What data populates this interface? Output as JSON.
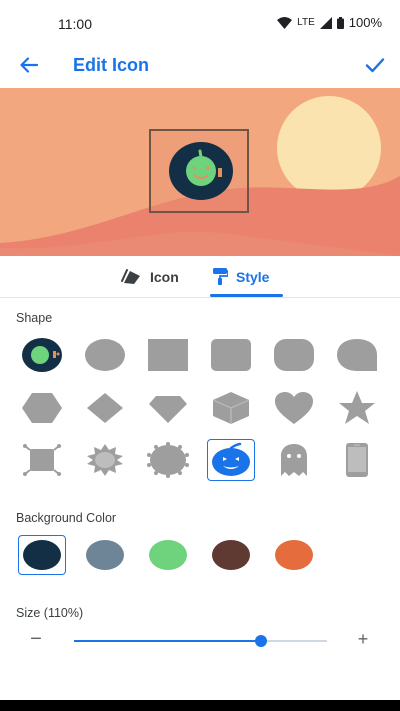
{
  "status_bar": {
    "time": "11:00",
    "network": "LTE",
    "battery": "100%"
  },
  "app_bar": {
    "title": "Edit Icon",
    "back_icon": "arrow-back-icon",
    "confirm_icon": "check-icon"
  },
  "colors": {
    "accent": "#1a73e8",
    "preview_sky": "#f2a77e",
    "preview_sun": "#fbe3b0",
    "preview_hill": "#ea826e"
  },
  "tabs": [
    {
      "label": "Icon",
      "icon": "cards-icon",
      "active": false
    },
    {
      "label": "Style",
      "icon": "paint-roller-icon",
      "active": true
    }
  ],
  "shape_section": {
    "label": "Shape",
    "shapes": [
      "original",
      "circle",
      "square",
      "rounded-square",
      "squircle",
      "teardrop",
      "hexagon",
      "diamond",
      "gem",
      "cube",
      "heart",
      "star",
      "frame",
      "sun",
      "scalloped",
      "pumpkin",
      "ghost",
      "phone"
    ],
    "selected_index": 15
  },
  "background_section": {
    "label": "Background Color",
    "colors": [
      "#132f46",
      "#6d8597",
      "#6fd37e",
      "#5f3a32",
      "#e56d3d"
    ],
    "selected_index": 0
  },
  "size_section": {
    "label": "Size (110%)",
    "value_fraction": 0.74,
    "minus": "−",
    "plus": "+"
  }
}
